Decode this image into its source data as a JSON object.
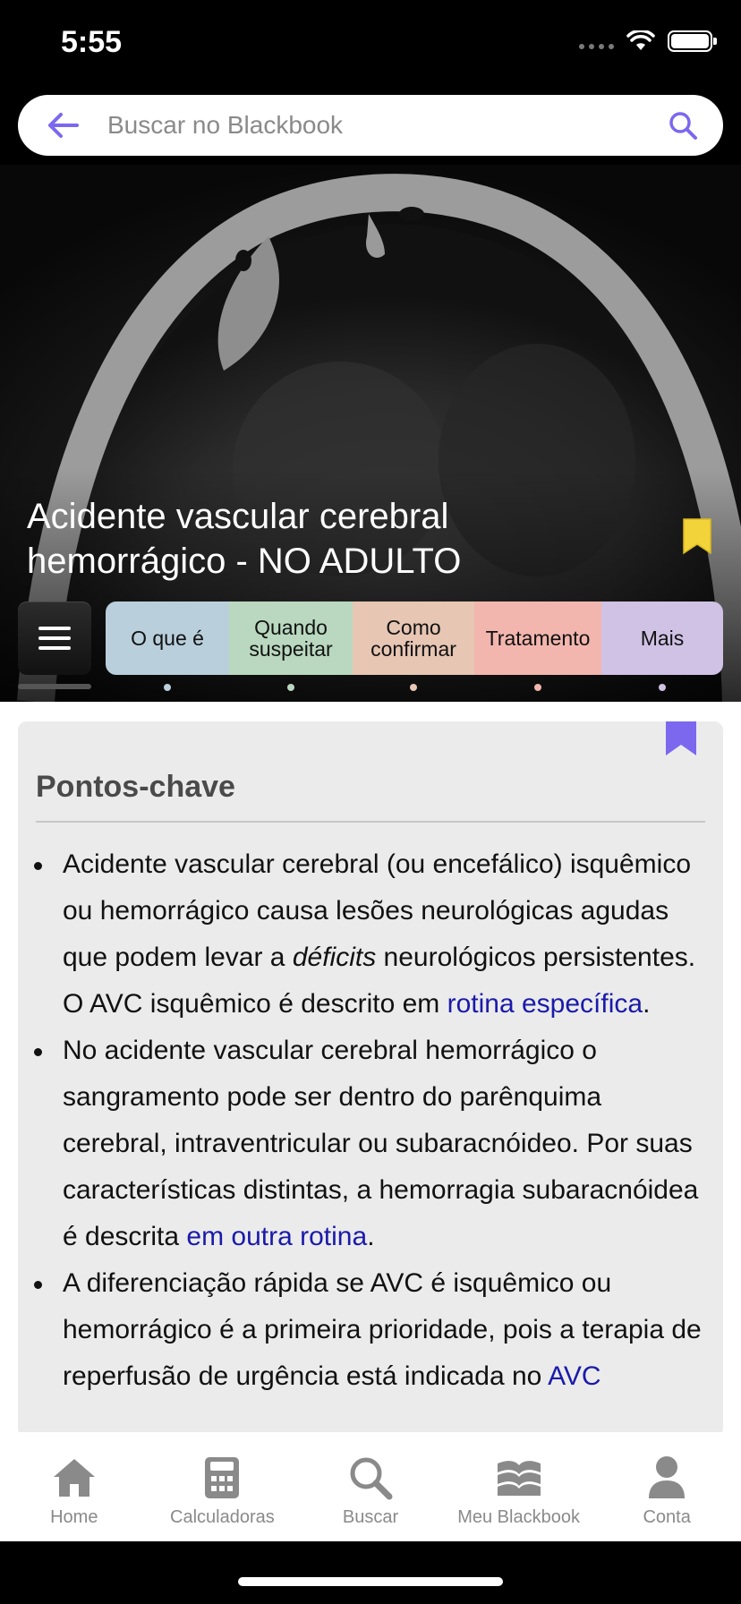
{
  "status_bar": {
    "time": "5:55"
  },
  "search": {
    "placeholder": "Buscar no Blackbook"
  },
  "article": {
    "title": "Acidente vascular cerebral hemorrágico - NO ADULTO"
  },
  "tabs": [
    {
      "label_line1": "O que é",
      "label_line2": "",
      "color": "#b9cfdc"
    },
    {
      "label_line1": "Quando",
      "label_line2": "suspeitar",
      "color": "#b9d8bf"
    },
    {
      "label_line1": "Como",
      "label_line2": "confirmar",
      "color": "#e7c6b4"
    },
    {
      "label_line1": "Tratamento",
      "label_line2": "",
      "color": "#f2b6ae"
    },
    {
      "label_line1": "Mais",
      "label_line2": "",
      "color": "#cfc2e4"
    }
  ],
  "section": {
    "title": "Pontos-chave",
    "bullets": [
      {
        "text_before": "Acidente vascular cerebral (ou encefálico) isquêmico ou hemorrágico causa lesões neurológicas agudas que podem levar a ",
        "italic": "déficits",
        "text_mid": " neurológicos persistentes. O AVC isquêmico é descrito em ",
        "link": "rotina específica",
        "text_after": "."
      },
      {
        "text_before": "No acidente vascular cerebral hemorrágico o sangramento pode ser dentro do parênquima cerebral, intraventricular ou subaracnóideo. Por suas características distintas, a hemorragia subaracnóidea é descrita ",
        "link": "em outra rotina",
        "text_after": "."
      },
      {
        "text_before": "A diferenciação rápida se AVC é isquêmico ou hemorrágico é a primeira prioridade, pois a terapia de reperfusão de urgência está indicada no ",
        "link": "AVC",
        "text_after": ""
      }
    ]
  },
  "bottom_nav": [
    {
      "label": "Home",
      "icon": "home-icon"
    },
    {
      "label": "Calculadoras",
      "icon": "calculator-icon"
    },
    {
      "label": "Buscar",
      "icon": "search-icon"
    },
    {
      "label": "Meu Blackbook",
      "icon": "book-icon"
    },
    {
      "label": "Conta",
      "icon": "person-icon"
    }
  ],
  "colors": {
    "accent_purple": "#7b68ee",
    "bookmark_yellow": "#f2d33a",
    "link_blue": "#1a1aaa",
    "card_bg": "#ebebeb"
  }
}
